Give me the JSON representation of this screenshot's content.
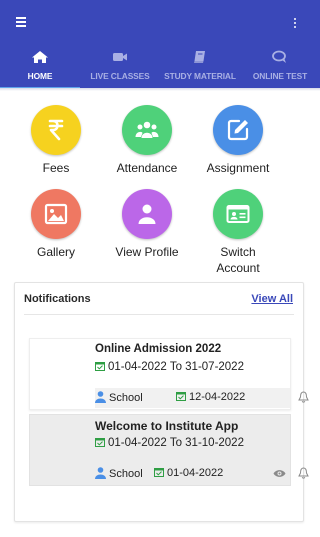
{
  "theme": {
    "primary": "#3a48b9",
    "tab_indicator": "#5fa4ec",
    "inactive_tab_text": "#a9b0e4"
  },
  "appbar": {
    "menu_icon": "hamburger-icon",
    "overflow_icon": "more-vertical-icon"
  },
  "tabs": [
    {
      "label": "HOME",
      "icon": "home-icon",
      "active": true
    },
    {
      "label": "LIVE CLASSES",
      "icon": "video-camera-icon",
      "active": false
    },
    {
      "label": "STUDY MATERIAL",
      "icon": "book-icon",
      "active": false
    },
    {
      "label": "ONLINE TEST",
      "icon": "chat-bubbles-icon",
      "active": false
    }
  ],
  "menu": [
    {
      "label": "Fees",
      "icon": "rupee-icon",
      "color": "#f6d21f"
    },
    {
      "label": "Attendance",
      "icon": "group-icon",
      "color": "#4fd17a"
    },
    {
      "label": "Assignment",
      "icon": "edit-icon",
      "color": "#4a8fe6"
    },
    {
      "label": "Gallery",
      "icon": "image-icon",
      "color": "#ef7862"
    },
    {
      "label": "View Profile",
      "icon": "person-icon",
      "color": "#bb67e8"
    },
    {
      "label": "Switch\nAccount",
      "icon": "id-card-icon",
      "color": "#4fd17a"
    }
  ],
  "notifications": {
    "title": "Notifications",
    "view_all": "View All",
    "items": [
      {
        "title": "Online Admission 2022",
        "dates": "01-04-2022 To 31-07-2022",
        "audience": "School",
        "posted": "12-04-2022"
      },
      {
        "title": "Welcome to  Institute App",
        "dates": "01-04-2022 To 31-10-2022",
        "audience": "School",
        "posted": "01-04-2022"
      }
    ]
  }
}
